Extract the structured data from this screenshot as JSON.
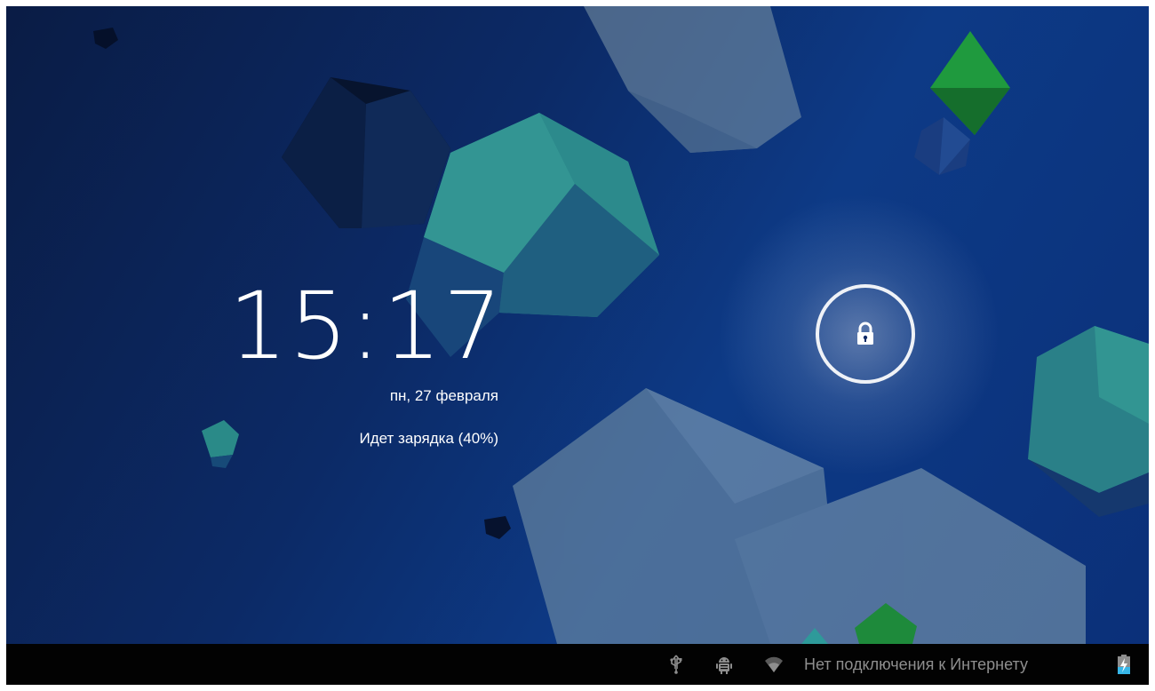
{
  "lockscreen": {
    "time": "15:17",
    "date": "пн, 27 февраля",
    "charging_status": "Идет зарядка (40%)",
    "battery_level_percent": 40,
    "unlock_icon": "lock-icon"
  },
  "status_bar": {
    "icons": [
      "usb-icon",
      "android-debug-icon",
      "wifi-icon",
      "battery-charging-icon"
    ],
    "network_status": "Нет подключения к Интернету"
  },
  "colors": {
    "wallpaper_dark": "#0a1c45",
    "wallpaper_blue": "#0d3a86",
    "teal_crystal": "#2f8f86",
    "green_crystal": "#1f9a3e",
    "status_bar_bg": "#020202",
    "status_text": "#8e8e8e",
    "battery_accent": "#37b6e8"
  }
}
